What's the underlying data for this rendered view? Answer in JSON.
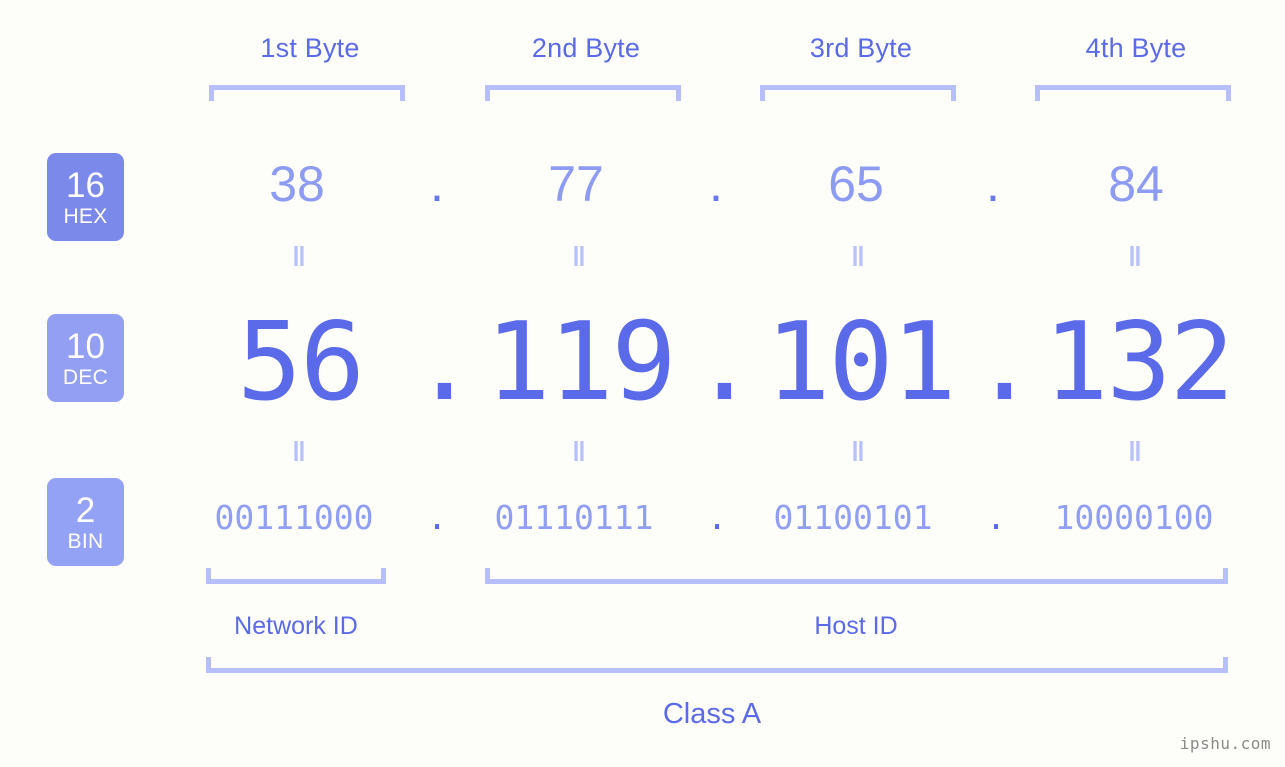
{
  "meta": {
    "watermark": "ipshu.com",
    "background_color": "#fdfdfa",
    "accent_strong": "#5a6ae8",
    "accent_mid": "#8d9bf2",
    "accent_light": "#b7bffa"
  },
  "headers": {
    "bytes": [
      "1st Byte",
      "2nd Byte",
      "3rd Byte",
      "4th Byte"
    ]
  },
  "bases": [
    {
      "id": "hex",
      "number": "16",
      "name": "HEX",
      "color": "#7b89ea"
    },
    {
      "id": "dec",
      "number": "10",
      "name": "DEC",
      "color": "#939ff2"
    },
    {
      "id": "bin",
      "number": "2",
      "name": "BIN",
      "color": "#94a2f5"
    }
  ],
  "separator": {
    "glyph": "‖"
  },
  "dot": ".",
  "rows": {
    "hex": {
      "label": "HEX",
      "values": [
        "38",
        "77",
        "65",
        "84"
      ]
    },
    "dec": {
      "label": "DEC",
      "values": [
        "56",
        "119",
        "101",
        "132"
      ]
    },
    "bin": {
      "label": "BIN",
      "values": [
        "00111000",
        "01110111",
        "01100101",
        "10000100"
      ]
    }
  },
  "ip_address": "56.119.101.132",
  "segments": {
    "network_id": "Network ID",
    "host_id": "Host ID",
    "class": "Class A"
  }
}
